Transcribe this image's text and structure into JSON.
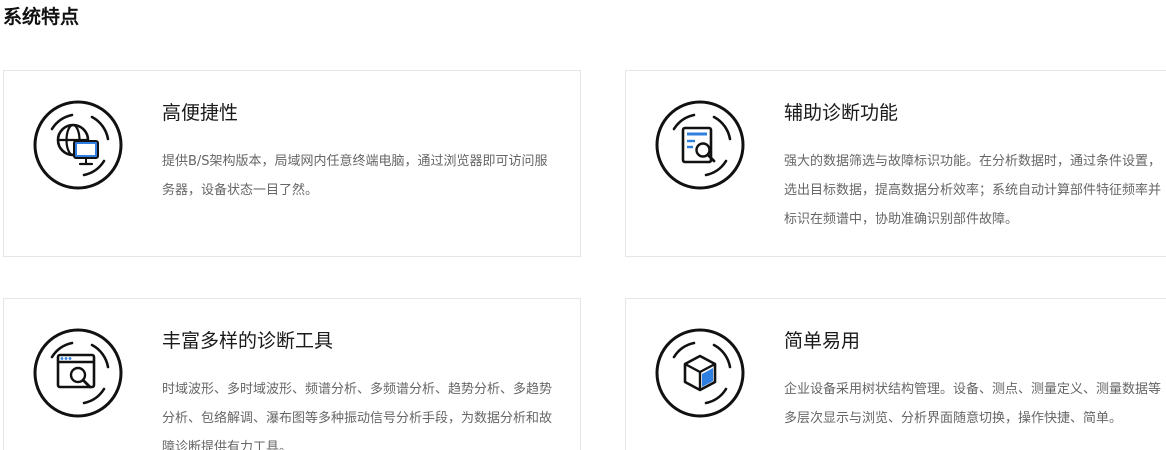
{
  "section": {
    "title": "系统特点"
  },
  "colors": {
    "icon_stroke": "#111111",
    "icon_accent": "#2f7fe0",
    "title": "#1a1a1a",
    "desc": "#666666",
    "border": "#e6e6e6"
  },
  "features": [
    {
      "icon": "globe-monitor-icon",
      "title": "高便捷性",
      "desc": "提供B/S架构版本，局域网内任意终端电脑，通过浏览器即可访问服务器，设备状态一目了然。"
    },
    {
      "icon": "document-search-icon",
      "title": "辅助诊断功能",
      "desc": "强大的数据筛选与故障标识功能。在分析数据时，通过条件设置，选出目标数据，提高数据分析效率；系统自动计算部件特征频率并标识在频谱中，协助准确识别部件故障。"
    },
    {
      "icon": "browser-search-icon",
      "title": "丰富多样的诊断工具",
      "desc": "时域波形、多时域波形、频谱分析、多频谱分析、趋势分析、多趋势分析、包络解调、瀑布图等多种振动信号分析手段，为数据分析和故障诊断提供有力工具。"
    },
    {
      "icon": "cube-icon",
      "title": "简单易用",
      "desc": "企业设备采用树状结构管理。设备、测点、测量定义、测量数据等多层次显示与浏览、分析界面随意切换，操作快捷、简单。"
    }
  ]
}
